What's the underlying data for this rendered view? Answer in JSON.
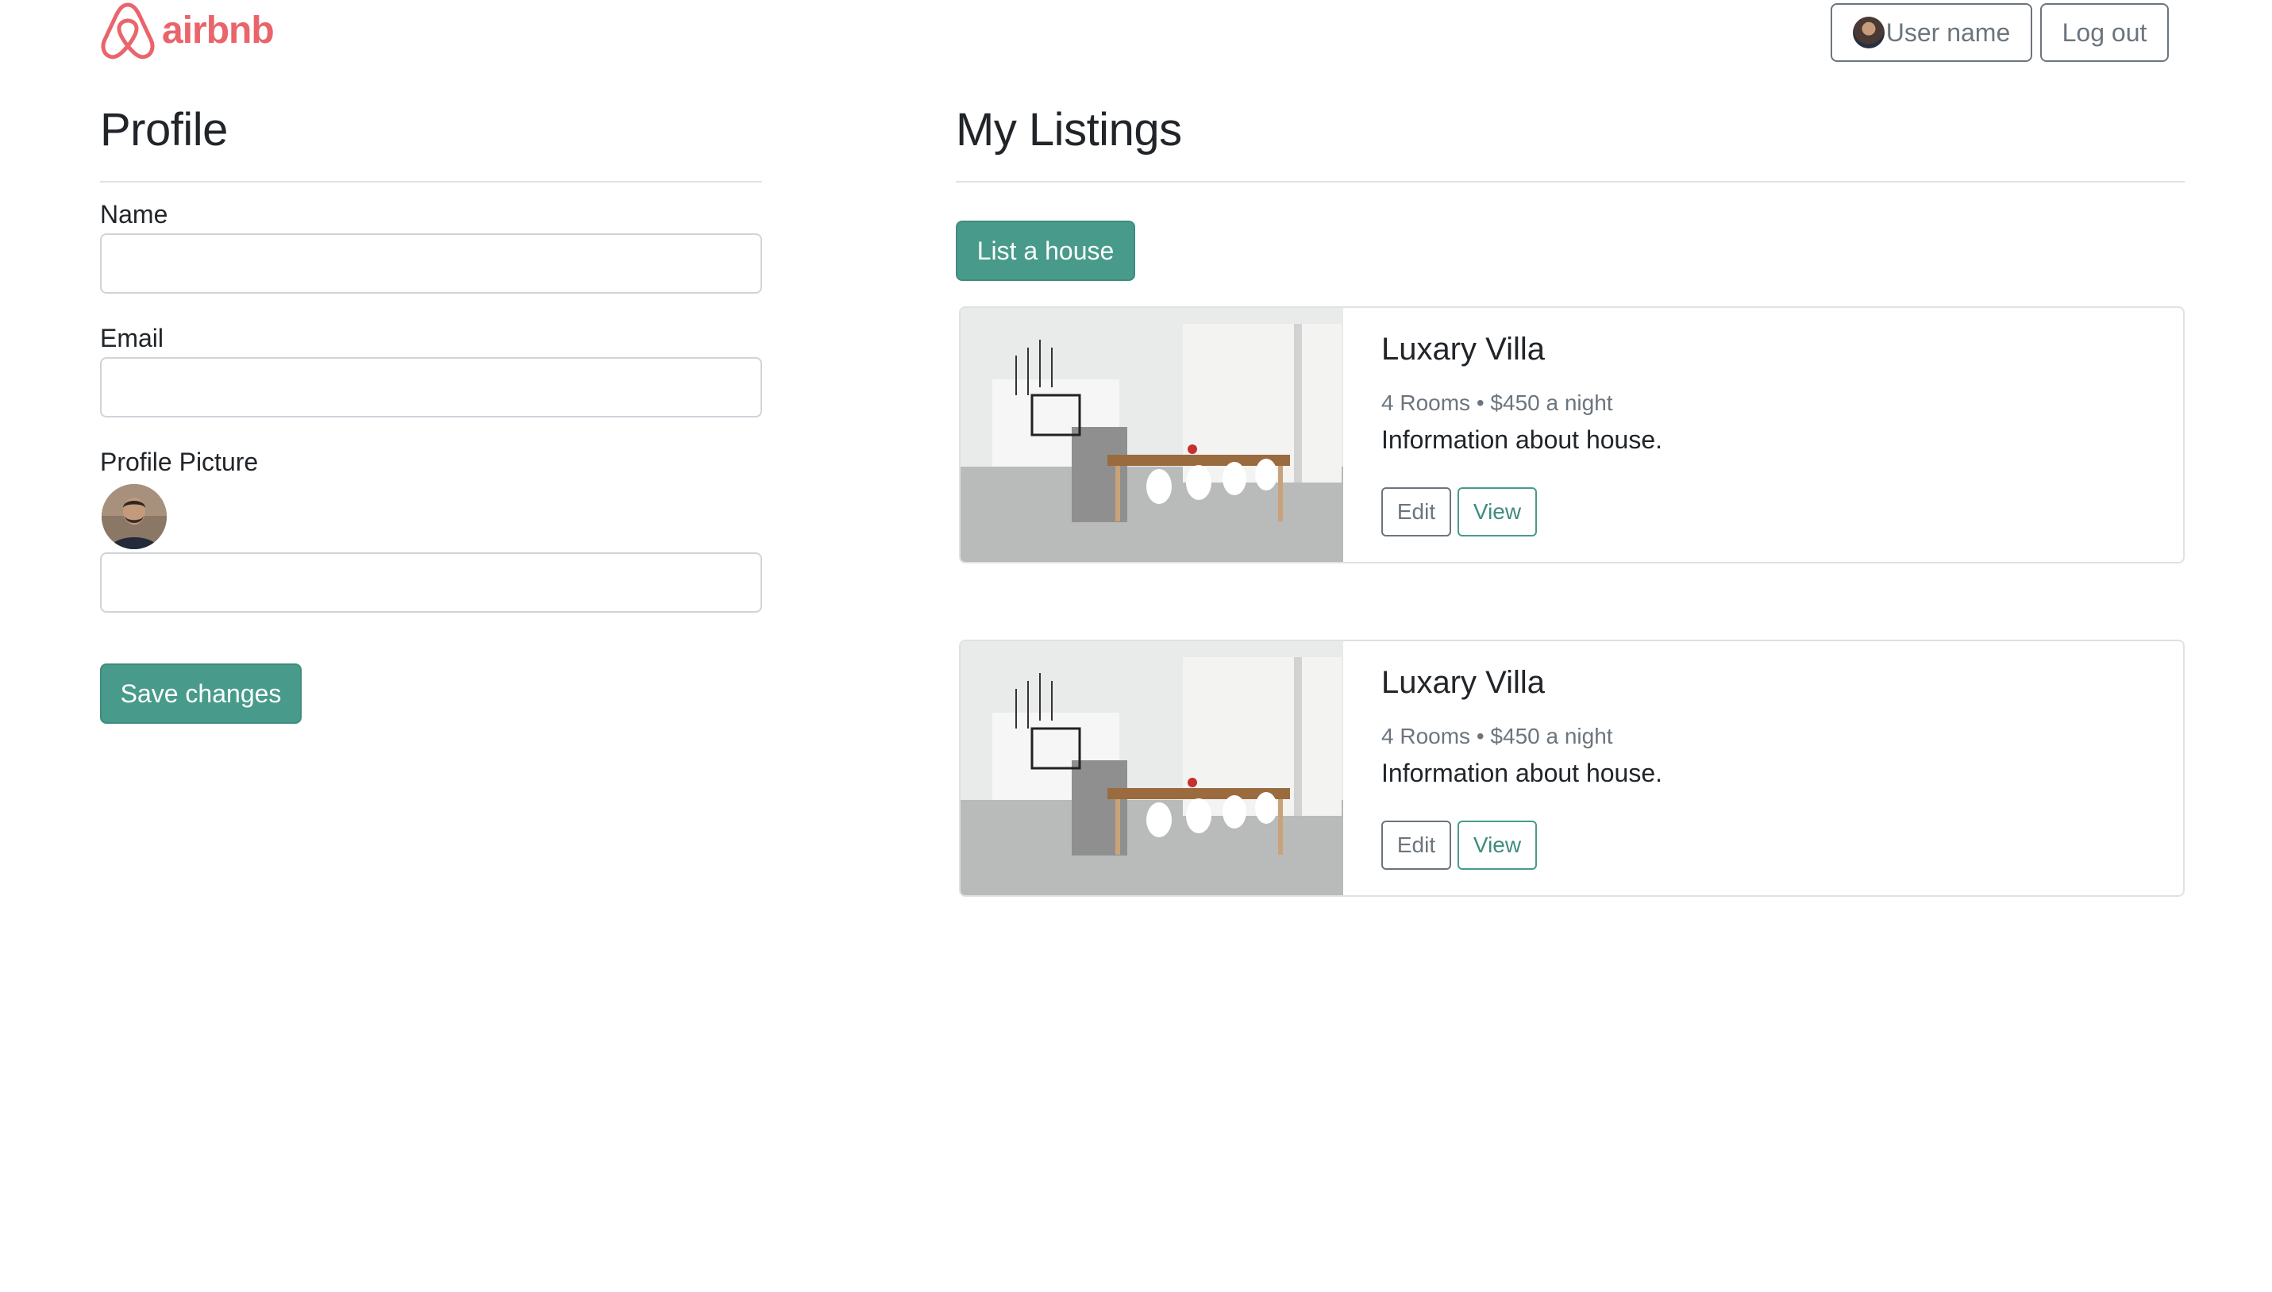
{
  "header": {
    "logo_text": "airbnb",
    "user_button_label": "User name",
    "logout_button_label": "Log out"
  },
  "profile": {
    "title": "Profile",
    "name_label": "Name",
    "name_value": "",
    "email_label": "Email",
    "email_value": "",
    "picture_label": "Profile Picture",
    "picture_value": "",
    "save_label": "Save changes"
  },
  "listings": {
    "title": "My Listings",
    "add_label": "List a house",
    "items": [
      {
        "title": "Luxary Villa",
        "rooms": "4 Rooms",
        "price": "$450 a night",
        "description": "Information about house.",
        "edit_label": "Edit",
        "view_label": "View"
      },
      {
        "title": "Luxary Villa",
        "rooms": "4 Rooms",
        "price": "$450 a night",
        "description": "Information about house.",
        "edit_label": "Edit",
        "view_label": "View"
      }
    ]
  },
  "colors": {
    "brand": "#ff5a5f",
    "primary": "#489b8b",
    "secondary": "#6c757d"
  }
}
